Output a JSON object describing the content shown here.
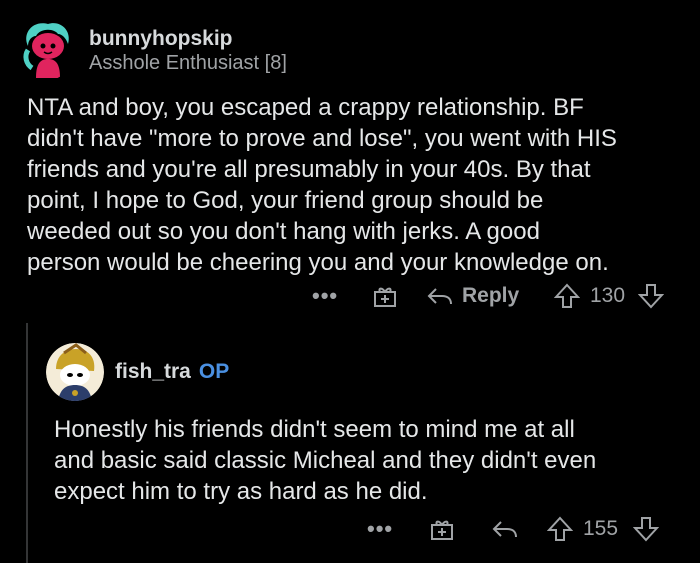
{
  "comments": [
    {
      "author": "bunnyhopskip",
      "flair": "Asshole Enthusiast [8]",
      "lines": [
        "NTA and boy, you escaped a crappy relationship. BF",
        "didn't have \"more to prove and lose\", you went with HIS",
        "friends and you're all presumably in your 40s. By that",
        "point, I hope to God, your friend group should be",
        "weeded out so you don't hang with jerks. A good",
        "person would be cheering you and your knowledge on."
      ],
      "more": "•••",
      "reply_label": "Reply",
      "score": "130"
    },
    {
      "author": "fish_tra",
      "op_badge": "OP",
      "lines": [
        "Honestly his friends didn't seem to mind me at all",
        "and basic said classic Micheal and they didn't even",
        "expect him to try as hard as he did."
      ],
      "more": "•••",
      "score": "155"
    }
  ],
  "colors": {
    "background": "#000000",
    "text": "#e5e7e8",
    "meta": "#a0a3a6",
    "op": "#4a90e2",
    "avatar_pink": "#e0245e",
    "avatar_teal": "#4fd1c5"
  },
  "icons": [
    "more-icon",
    "award-icon",
    "reply-icon",
    "upvote-icon",
    "downvote-icon"
  ]
}
